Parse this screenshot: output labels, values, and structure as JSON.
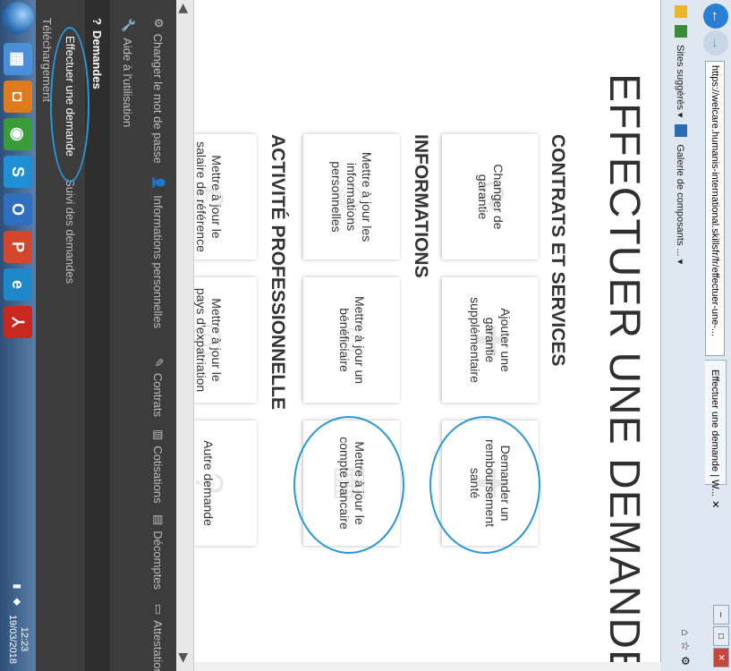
{
  "browser": {
    "url": "https://welcare.humanis-international.skillsfr/fr/effectuer-une-...",
    "tab_title": "Effectuer une demande | W...",
    "favorites": [
      "Sites suggérés ▾",
      "Galerie de composants ... ▾"
    ]
  },
  "page": {
    "title": "EFFECTUER UNE DEMANDE"
  },
  "sections": [
    {
      "title": "CONTRATS ET SERVICES",
      "cards": [
        "Changer de garantie",
        "Ajouter une garantie supplémentaire",
        "Demander un remboursement santé"
      ]
    },
    {
      "title": "INFORMATIONS",
      "cards": [
        "Mettre à jour les informations personnelles",
        "Mettre à jour un bénéficiaire",
        "Mettre à jour le compte bancaire"
      ]
    },
    {
      "title": "ACTIVITÉ PROFESSIONNELLE",
      "cards": [
        "Mettre à jour le salaire de référence",
        "Mettre à jour le pays d'expatriation",
        "Autre demande"
      ]
    }
  ],
  "sidebar": {
    "row1": [
      "Changer le mot de passe",
      "Informations personnelles",
      "Contrats",
      "Cotisations",
      "Décomptes",
      "Attestation d'assurance"
    ],
    "row2": [
      "Aide à l'utilisation"
    ],
    "demandes": "Demandes",
    "submenu": [
      "Effectuer une demande",
      "Suivi des demandes"
    ],
    "telechargement": "Téléchargement"
  },
  "taskbar": {
    "time": "12:23",
    "date": "19/03/2018"
  }
}
